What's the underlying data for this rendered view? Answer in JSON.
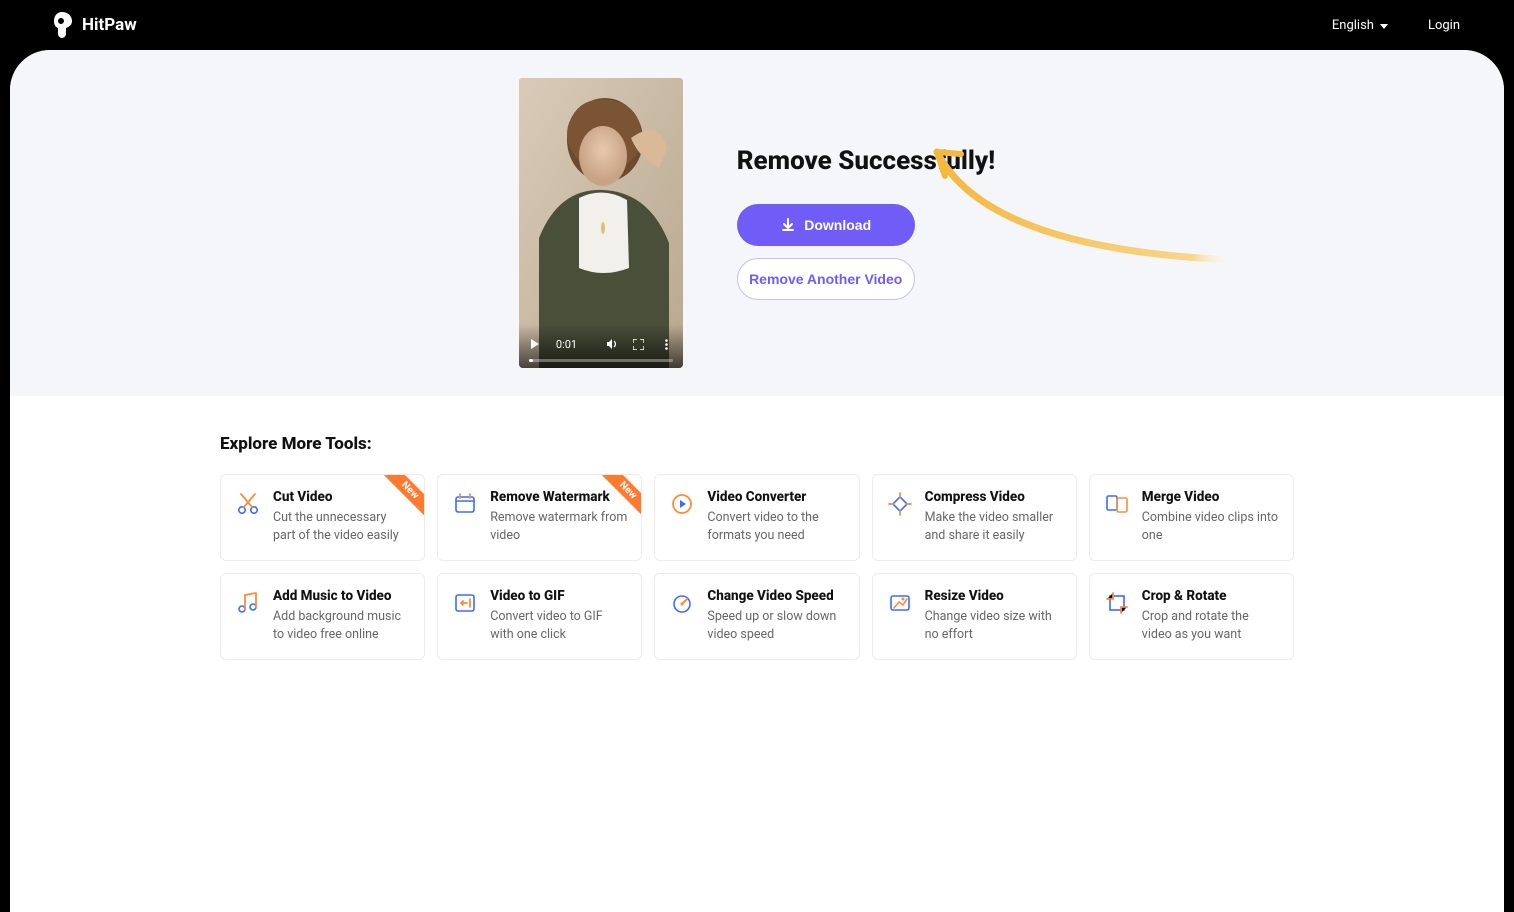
{
  "header": {
    "brand": "HitPaw",
    "language": "English",
    "login": "Login"
  },
  "hero": {
    "title": "Remove Successfully!",
    "download_label": "Download",
    "another_label": "Remove Another Video",
    "video_time": "0:01"
  },
  "tools_heading": "Explore More Tools:",
  "badge_new_label": "New",
  "tools": [
    {
      "title": "Cut Video",
      "desc": "Cut the unnecessary part of the video easily",
      "new": true
    },
    {
      "title": "Remove Watermark",
      "desc": "Remove watermark from video",
      "new": true
    },
    {
      "title": "Video Converter",
      "desc": "Convert video to the formats you need",
      "new": false
    },
    {
      "title": "Compress Video",
      "desc": "Make the video smaller and share it easily",
      "new": false
    },
    {
      "title": "Merge Video",
      "desc": "Combine video clips into one",
      "new": false
    },
    {
      "title": "Add Music to Video",
      "desc": "Add background music to video free online",
      "new": false
    },
    {
      "title": "Video to GIF",
      "desc": "Convert video to GIF with one click",
      "new": false
    },
    {
      "title": "Change Video Speed",
      "desc": "Speed up or slow down video speed",
      "new": false
    },
    {
      "title": "Resize Video",
      "desc": "Change video size with no effort",
      "new": false
    },
    {
      "title": "Crop & Rotate",
      "desc": "Crop and rotate the video as you want",
      "new": false
    }
  ]
}
